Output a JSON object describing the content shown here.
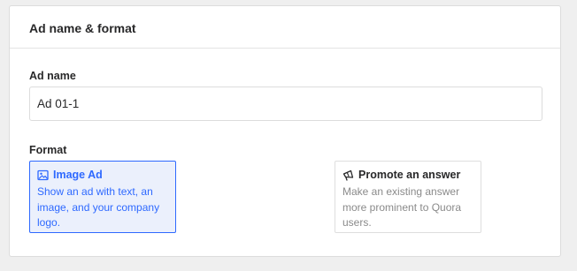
{
  "section": {
    "title": "Ad name & format"
  },
  "ad_name": {
    "label": "Ad name",
    "value": "Ad 01-1"
  },
  "format": {
    "label": "Format",
    "options": [
      {
        "title": "Image Ad",
        "description": "Show an ad with text, an image, and your company logo.",
        "icon": "image-icon",
        "selected": true
      },
      {
        "title": "Promote an answer",
        "description": "Make an existing answer more prominent to Quora users.",
        "icon": "megaphone-icon",
        "selected": false
      }
    ]
  },
  "colors": {
    "accent": "#2e69ff",
    "selected_bg": "#ebf0fc",
    "muted_text": "#8a8a8a"
  }
}
